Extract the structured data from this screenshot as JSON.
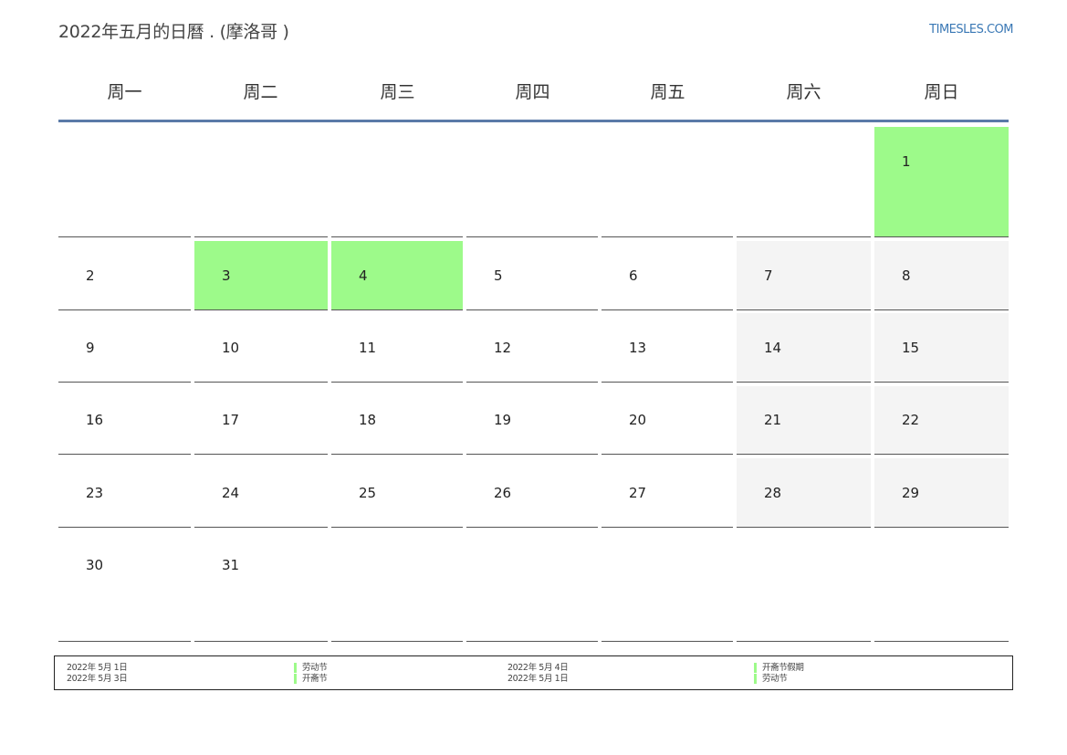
{
  "header": {
    "title": "2022年五月的日曆 . (摩洛哥 )",
    "site": "TIMESLES.COM"
  },
  "weekdays": [
    "周一",
    "周二",
    "周三",
    "周四",
    "周五",
    "周六",
    "周日"
  ],
  "days": [
    "1",
    "2",
    "3",
    "4",
    "5",
    "6",
    "7",
    "8",
    "9",
    "10",
    "11",
    "12",
    "13",
    "14",
    "15",
    "16",
    "17",
    "18",
    "19",
    "20",
    "21",
    "22",
    "23",
    "24",
    "25",
    "26",
    "27",
    "28",
    "29",
    "30",
    "31"
  ],
  "colors": {
    "holiday": "#9dfa8a",
    "weekend": "#f4f4f4",
    "header_line": "#5a7aa8",
    "link": "#3a78b5"
  },
  "holidays": [
    {
      "date": "2022年 5月 1日",
      "name": "劳动节"
    },
    {
      "date": "2022年 5月 3日",
      "name": "开斋节"
    },
    {
      "date": "2022年 5月 4日",
      "name": "开斋节假期"
    },
    {
      "date": "2022年 5月 1日",
      "name": "劳动节"
    }
  ]
}
